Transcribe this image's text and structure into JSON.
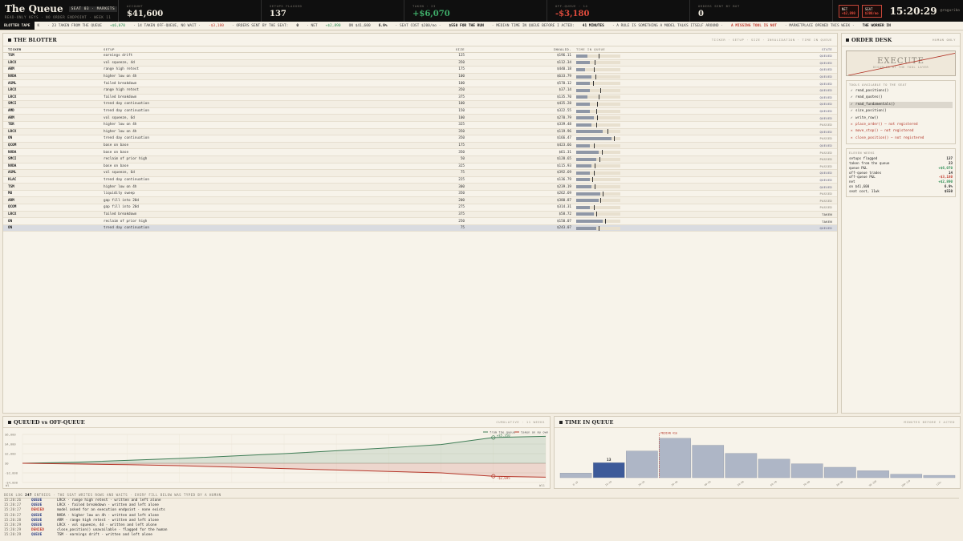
{
  "header": {
    "logo": "The Queue",
    "seat": "SEAT 03 · MARKETS",
    "subtitle": "READ-ONLY KEYS · NO ORDER ENDPOINT · WEEK 11",
    "stats": [
      {
        "label": "ACCOUNT",
        "value": "$41,600",
        "tone": "plain"
      },
      {
        "label": "SETUPS FLAGGED",
        "value": "137",
        "tone": "plain"
      },
      {
        "label": "TAKEN · 23",
        "value": "+$6,070",
        "tone": "pos"
      },
      {
        "label": "OFF-QUEUE · 14",
        "value": "-$3,180",
        "tone": "neg"
      },
      {
        "label": "ORDERS SENT BY BOT",
        "value": "0",
        "tone": "plain"
      }
    ],
    "net_chip": {
      "label": "NET",
      "value": "+$2,890"
    },
    "seat_chip": {
      "label": "SEAT",
      "value": "$200/mo"
    },
    "clock": "15:20:29",
    "handle": "@raguriko"
  },
  "tape": {
    "label": "BLOTTER TAPE",
    "items": [
      {
        "text": "K",
        "tone": ""
      },
      {
        "text": "· 23 TAKEN FROM THE QUEUE",
        "tone": ""
      },
      {
        "text": "+$6,070",
        "tone": "pos"
      },
      {
        "text": "· 14 TAKEN OFF-QUEUE, NO WAIT ·",
        "tone": ""
      },
      {
        "text": "-$3,180",
        "tone": "neg"
      },
      {
        "text": "· ORDERS SENT BY THE SEAT:",
        "tone": ""
      },
      {
        "text": "0",
        "tone": "b"
      },
      {
        "text": "· NET",
        "tone": ""
      },
      {
        "text": "+$2,890",
        "tone": "pos"
      },
      {
        "text": "ON $41,600",
        "tone": ""
      },
      {
        "text": "6.9%",
        "tone": "b"
      },
      {
        "text": "· SEAT COST $200/mo ·",
        "tone": ""
      },
      {
        "text": "$550 FOR THE RUN",
        "tone": "b"
      },
      {
        "text": "· MEDIAN TIME IN QUEUE BEFORE I ACTED:",
        "tone": ""
      },
      {
        "text": "41 MINUTES",
        "tone": "b"
      },
      {
        "text": "· A RULE IS SOMETHING A MODEL TALKS ITSELF AROUND ·",
        "tone": ""
      },
      {
        "text": "A MISSING TOOL IS NOT",
        "tone": "red"
      },
      {
        "text": "· MARKETPLACE OPENED THIS WEEK ·",
        "tone": ""
      },
      {
        "text": "THE WORKER IN",
        "tone": "b"
      }
    ]
  },
  "blotter": {
    "title": "THE BLOTTER",
    "meta": "TICKER · SETUP · SIZE · INVALIDATION · TIME IN QUEUE",
    "columns": {
      "ticker": "TICKER",
      "setup": "SETUP",
      "size": "SIZE",
      "inval": "INVALID.",
      "tiq": "TIME IN QUEUE",
      "state": "STATE"
    },
    "rows": [
      {
        "ticker": "TSM",
        "setup": "earnings drift",
        "size": "125",
        "inval": "$196.11",
        "tiq": 0.25,
        "mark": 0.5,
        "state": "QUEUED"
      },
      {
        "ticker": "LRCX",
        "setup": "vol squeeze, 4d",
        "size": "350",
        "inval": "$112.34",
        "tiq": 0.3,
        "mark": 0.42,
        "state": "QUEUED"
      },
      {
        "ticker": "ARM",
        "setup": "range high retest",
        "size": "175",
        "inval": "$440.18",
        "tiq": 0.2,
        "mark": 0.4,
        "state": "QUEUED"
      },
      {
        "ticker": "NVDA",
        "setup": "higher low on 4h",
        "size": "100",
        "inval": "$633.79",
        "tiq": 0.35,
        "mark": 0.44,
        "state": "QUEUED"
      },
      {
        "ticker": "ASML",
        "setup": "failed breakdown",
        "size": "100",
        "inval": "$570.12",
        "tiq": 0.3,
        "mark": 0.38,
        "state": "QUEUED"
      },
      {
        "ticker": "LRCX",
        "setup": "range high retest",
        "size": "350",
        "inval": "$37.14",
        "tiq": 0.3,
        "mark": 0.55,
        "state": "QUEUED"
      },
      {
        "ticker": "LRCX",
        "setup": "failed breakdown",
        "size": "375",
        "inval": "$135.70",
        "tiq": 0.25,
        "mark": 0.5,
        "state": "QUEUED"
      },
      {
        "ticker": "SMCI",
        "setup": "trend day continuation",
        "size": "100",
        "inval": "$435.28",
        "tiq": 0.3,
        "mark": 0.48,
        "state": "QUEUED"
      },
      {
        "ticker": "AMD",
        "setup": "trend day continuation",
        "size": "150",
        "inval": "$322.55",
        "tiq": 0.3,
        "mark": 0.46,
        "state": "QUEUED"
      },
      {
        "ticker": "ARM",
        "setup": "vol squeeze, 6d",
        "size": "100",
        "inval": "$270.79",
        "tiq": 0.4,
        "mark": 0.48,
        "state": "QUEUED"
      },
      {
        "ticker": "TER",
        "setup": "higher low on 4h",
        "size": "325",
        "inval": "$339.48",
        "tiq": 0.35,
        "mark": 0.45,
        "state": "PASSED"
      },
      {
        "ticker": "LRCX",
        "setup": "higher low on 4h",
        "size": "350",
        "inval": "$119.96",
        "tiq": 0.6,
        "mark": 0.7,
        "state": "QUEUED"
      },
      {
        "ticker": "ON",
        "setup": "trend day continuation",
        "size": "350",
        "inval": "$166.47",
        "tiq": 0.8,
        "mark": 0.86,
        "state": "PASSED"
      },
      {
        "ticker": "QCOM",
        "setup": "base on base",
        "size": "175",
        "inval": "$423.66",
        "tiq": 0.3,
        "mark": 0.4,
        "state": "QUEUED"
      },
      {
        "ticker": "NVDA",
        "setup": "base on base",
        "size": "350",
        "inval": "$61.31",
        "tiq": 0.5,
        "mark": 0.58,
        "state": "PASSED"
      },
      {
        "ticker": "SMCI",
        "setup": "reclaim of prior high",
        "size": "50",
        "inval": "$120.65",
        "tiq": 0.45,
        "mark": 0.52,
        "state": "PASSED"
      },
      {
        "ticker": "NVDA",
        "setup": "base on base",
        "size": "325",
        "inval": "$115.93",
        "tiq": 0.35,
        "mark": 0.42,
        "state": "PASSED"
      },
      {
        "ticker": "ASML",
        "setup": "vol squeeze, 6d",
        "size": "75",
        "inval": "$392.69",
        "tiq": 0.3,
        "mark": 0.4,
        "state": "QUEUED"
      },
      {
        "ticker": "KLAC",
        "setup": "trend day continuation",
        "size": "225",
        "inval": "$136.79",
        "tiq": 0.3,
        "mark": 0.36,
        "state": "QUEUED"
      },
      {
        "ticker": "TSM",
        "setup": "higher low on 4h",
        "size": "300",
        "inval": "$239.19",
        "tiq": 0.35,
        "mark": 0.42,
        "state": "QUEUED"
      },
      {
        "ticker": "MU",
        "setup": "liquidity sweep",
        "size": "350",
        "inval": "$262.69",
        "tiq": 0.55,
        "mark": 0.6,
        "state": "PASSED"
      },
      {
        "ticker": "ARM",
        "setup": "gap fill into 20d",
        "size": "200",
        "inval": "$380.87",
        "tiq": 0.5,
        "mark": 0.55,
        "state": "PASSED"
      },
      {
        "ticker": "QCOM",
        "setup": "gap fill into 20d",
        "size": "275",
        "inval": "$314.31",
        "tiq": 0.3,
        "mark": 0.4,
        "state": "PASSED"
      },
      {
        "ticker": "LRCX",
        "setup": "failed breakdown",
        "size": "375",
        "inval": "$58.72",
        "tiq": 0.4,
        "mark": 0.45,
        "state": "TAKEN"
      },
      {
        "ticker": "ON",
        "setup": "reclaim of prior high",
        "size": "250",
        "inval": "$150.07",
        "tiq": 0.6,
        "mark": 0.65,
        "state": "TAKEN"
      },
      {
        "ticker": "ON",
        "setup": "trend day continuation",
        "size": "75",
        "inval": "$243.07",
        "tiq": 0.45,
        "mark": 0.5,
        "state": "QUEUED"
      }
    ]
  },
  "desk": {
    "title": "ORDER DESK",
    "meta": "HUMAN ONLY",
    "execute_label": "EXECUTE",
    "execute_sub": "DISABLED AT THE TOOL LAYER",
    "tools_label": "TOOLS AVAILABLE TO THE SEAT",
    "tools": [
      {
        "mark": "✓",
        "name": "read_positions()",
        "ok": true,
        "hl": false
      },
      {
        "mark": "✓",
        "name": "read_quotes()",
        "ok": true,
        "hl": false
      },
      {
        "mark": "✓",
        "name": "read_fundamentals()",
        "ok": true,
        "hl": true
      },
      {
        "mark": "✓",
        "name": "size_position()",
        "ok": true,
        "hl": false
      },
      {
        "mark": "✓",
        "name": "write_row()",
        "ok": true,
        "hl": false
      },
      {
        "mark": "✕",
        "name": "place_order()  — not registered",
        "ok": false,
        "hl": false
      },
      {
        "mark": "✕",
        "name": "move_stop()  — not registered",
        "ok": false,
        "hl": false
      },
      {
        "mark": "✕",
        "name": "close_position()  — not registered",
        "ok": false,
        "hl": false
      }
    ],
    "eleven_label": "ELEVEN WEEKS",
    "eleven": [
      {
        "k": "setups flagged",
        "v": "137",
        "tone": ""
      },
      {
        "k": "taken from the queue",
        "v": "23",
        "tone": ""
      },
      {
        "k": "queue P&L",
        "v": "+$6,070",
        "tone": "pos"
      },
      {
        "k": "off-queue trades",
        "v": "14",
        "tone": ""
      },
      {
        "k": "off-queue P&L",
        "v": "-$3,180",
        "tone": "neg"
      },
      {
        "k": "net",
        "v": "+$2,890",
        "tone": "pos"
      },
      {
        "k": "on $41,600",
        "v": "6.9%",
        "tone": ""
      },
      {
        "k": "seat cost, 11wk",
        "v": "$550",
        "tone": ""
      }
    ]
  },
  "queued_chart": {
    "title": "QUEUED vs OFF-QUEUE",
    "meta": "CUMULATIVE · 11 WEEKS",
    "legend": [
      "from the queue",
      "taken on my own"
    ],
    "y_ticks": [
      "$6,000",
      "$4,000",
      "$2,000",
      "$0",
      "-$2,000",
      "-$4,000"
    ],
    "x_start": "W1",
    "x_end": "W11",
    "end_queue_label": "+$5,350",
    "end_off_label": "-$2,695",
    "queue_colors": {
      "queue": "#3f7d56",
      "off": "#b6382b"
    }
  },
  "chart_data": [
    {
      "type": "area",
      "title": "QUEUED vs OFF-QUEUE",
      "x": [
        1,
        2,
        3,
        4,
        5,
        6,
        7,
        8,
        9,
        10,
        11
      ],
      "series": [
        {
          "name": "from the queue",
          "values": [
            0,
            200,
            600,
            1000,
            1500,
            2000,
            2600,
            3200,
            3900,
            5350,
            5600
          ]
        },
        {
          "name": "taken on my own",
          "values": [
            0,
            -150,
            -300,
            -500,
            -800,
            -1100,
            -1400,
            -1700,
            -2000,
            -2695,
            -2900
          ]
        }
      ],
      "ylim": [
        -4000,
        6000
      ]
    },
    {
      "type": "bar",
      "title": "TIME IN QUEUE",
      "subtitle": "MINUTES BEFORE I ACTED",
      "categories": [
        "0-10",
        "10-20",
        "20-30",
        "30-40",
        "40-50",
        "50-60",
        "60-70",
        "70-80",
        "80-90",
        "90-100",
        "100-110",
        "110+"
      ],
      "values": [
        4,
        13,
        23,
        34,
        28,
        21,
        16,
        12,
        9,
        6,
        3,
        2
      ],
      "highlight_index": 1,
      "highlight_label": "13",
      "median_label": "MEDIAN 41m"
    }
  ],
  "time_chart": {
    "title": "TIME IN QUEUE",
    "meta": "MINUTES BEFORE I ACTED"
  },
  "log": {
    "label": "DESK LOG",
    "count": "247",
    "desc": "ENTRIES · THE SEAT WRITES ROWS AND WAITS · EVERY FILL BELOW WAS TYPED BY A HUMAN",
    "rows": [
      {
        "ts": "15:20:26",
        "kind": "QUEUE",
        "msg": "LRCX · range high retest · written and left alone"
      },
      {
        "ts": "15:20:27",
        "kind": "QUEUE",
        "msg": "LRCX · failed breakdown · written and left alone"
      },
      {
        "ts": "15:20:27",
        "kind": "DENIED",
        "msg": "model asked for an execution endpoint · none exists"
      },
      {
        "ts": "15:20:27",
        "kind": "QUEUE",
        "msg": "NVDA · higher low on 4h · written and left alone"
      },
      {
        "ts": "15:20:28",
        "kind": "QUEUE",
        "msg": "ARM · range high retest · written and left alone"
      },
      {
        "ts": "15:20:29",
        "kind": "QUEUE",
        "msg": "LRCX · vol squeeze, 4d · written and left alone"
      },
      {
        "ts": "15:20:29",
        "kind": "DENIED",
        "msg": "close_position() unavailable · flagged for the human"
      },
      {
        "ts": "15:20:29",
        "kind": "QUEUE",
        "msg": "TSM · earnings drift · written and left alone"
      }
    ]
  }
}
